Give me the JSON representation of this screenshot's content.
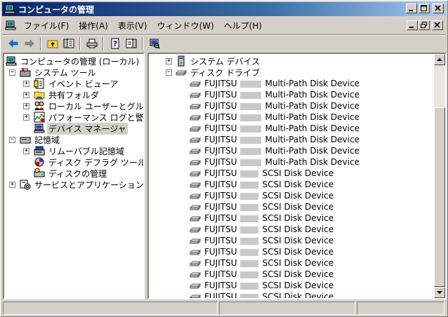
{
  "window": {
    "title": "コンピュータの管理"
  },
  "menubar": {
    "items": [
      {
        "label": "ファイル(F)"
      },
      {
        "label": "操作(A)"
      },
      {
        "label": "表示(V)"
      },
      {
        "label": "ウィンドウ(W)"
      },
      {
        "label": "ヘルプ(H)"
      }
    ]
  },
  "tree": {
    "root": "コンピュータの管理 (ローカル)",
    "system_tools": "システム ツール",
    "event_viewer": "イベント ビューア",
    "shared_folders": "共有フォルダ",
    "local_users": "ローカル ユーザーとグループ",
    "performance": "パフォーマンス ログと警告",
    "device_manager": "デバイス マネージャ",
    "storage": "記憶域",
    "removable_storage": "リムーバブル記憶域",
    "defrag": "ディスク デフラグ ツール",
    "disk_management": "ディスクの管理",
    "services_apps": "サービスとアプリケーション"
  },
  "devices": {
    "system_devices": "システム デバイス",
    "disk_drives": "ディスク ドライブ",
    "vendor": "FUJITSU",
    "multipath_name": "Multi-Path Disk Device",
    "scsi_name": "SCSI Disk Device",
    "multipath_count": 8,
    "scsi_count": 12
  }
}
